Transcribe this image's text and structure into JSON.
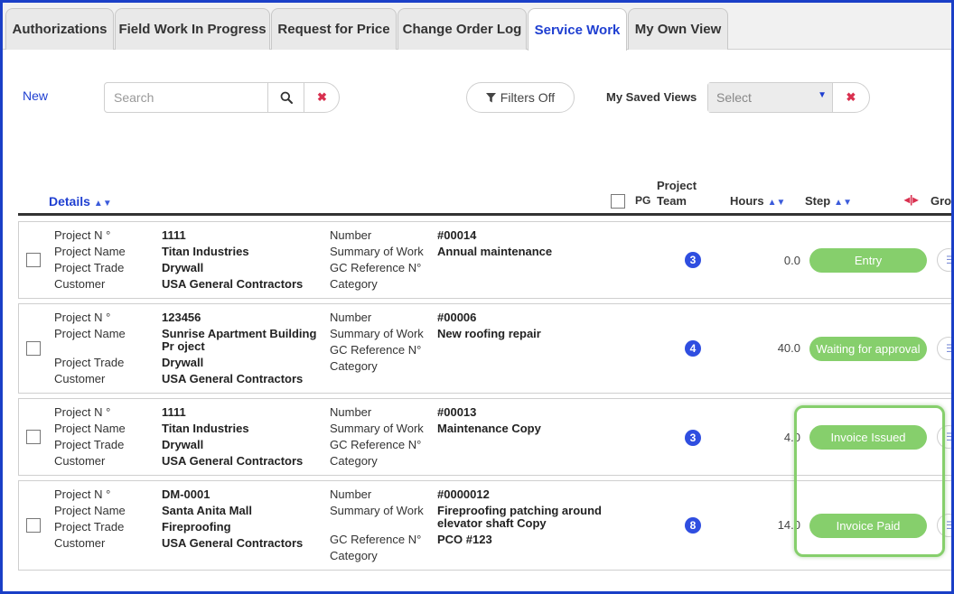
{
  "tabs": [
    {
      "label": "Authorizations"
    },
    {
      "label": "Field Work In Progress"
    },
    {
      "label": "Request for Price"
    },
    {
      "label": "Change Order Log"
    },
    {
      "label": "Service Work"
    },
    {
      "label": "My Own View"
    }
  ],
  "active_tab": "Service Work",
  "toolbar": {
    "new_label": "New",
    "search_placeholder": "Search",
    "filters_label": "Filters Off",
    "saved_views_label": "My Saved Views",
    "saved_views_value": "Select"
  },
  "headers": {
    "details": "Details",
    "pg": "PG",
    "project_team": [
      "Project",
      "Team"
    ],
    "hours": "Hours",
    "step": "Step",
    "group_partial": "Gro"
  },
  "field_labels": {
    "project_number": "Project N °",
    "project_name": "Project Name",
    "project_trade": "Project Trade",
    "customer": "Customer",
    "number": "Number",
    "summary": "Summary of Work",
    "gc_reference": "GC Reference N°",
    "category": "Category"
  },
  "rows": [
    {
      "project_number": "1111",
      "project_name": "Titan Industries",
      "project_trade": "Drywall",
      "customer": "USA General Contractors",
      "number": "#00014",
      "summary": "Annual maintenance",
      "gc_reference": "",
      "category": "",
      "team": "3",
      "hours": "0.0",
      "step": "Entry"
    },
    {
      "project_number": "123456",
      "project_name": "Sunrise Apartment Building Pr oject",
      "project_trade": "Drywall",
      "customer": "USA General Contractors",
      "number": "#00006",
      "summary": "New roofing repair",
      "gc_reference": "",
      "category": "",
      "team": "4",
      "hours": "40.0",
      "step": "Waiting for approval"
    },
    {
      "project_number": "1111",
      "project_name": "Titan Industries",
      "project_trade": "Drywall",
      "customer": "USA General Contractors",
      "number": "#00013",
      "summary": "Maintenance Copy",
      "gc_reference": "",
      "category": "",
      "team": "3",
      "hours": "4.0",
      "step": "Invoice Issued"
    },
    {
      "project_number": "DM-0001",
      "project_name": "Santa Anita Mall",
      "project_trade": "Fireproofing",
      "customer": "USA General Contractors",
      "number": "#0000012",
      "summary": "Fireproofing patching around elevator shaft Copy",
      "gc_reference": "PCO #123",
      "category": "",
      "team": "8",
      "hours": "14.0",
      "step": "Invoice Paid"
    }
  ],
  "colors": {
    "accent": "#1f3fd1",
    "step_green": "#86cf6c",
    "badge_blue": "#2f4ee0",
    "clear_red": "#d9304f"
  }
}
